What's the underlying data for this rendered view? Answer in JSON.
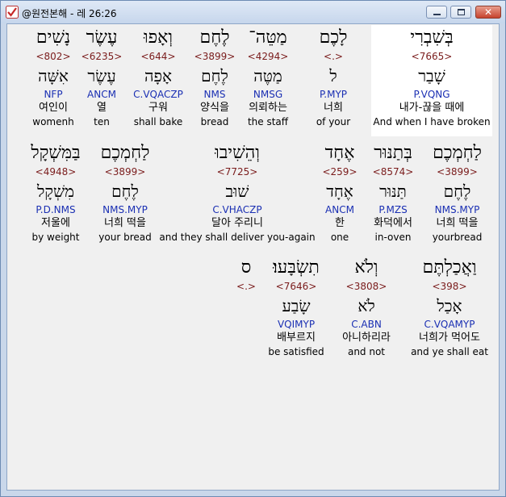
{
  "window": {
    "title": "@원전본해 - 레 26:26",
    "icon": "app-checkmark-icon",
    "close_label": "✕",
    "colors": {
      "strong": "#7a1c1c",
      "morph": "#1a2fb3",
      "title_bg": "#c6d6ec"
    }
  },
  "rows": [
    {
      "words": [
        {
          "heb": "בְּשִׁבְרִי",
          "strong": "<7665>",
          "lemma": "שָׁבַר",
          "morph": "P.VQNG",
          "ko": "내가-끊을 때에",
          "en": "And when I have broken",
          "selected": true
        },
        {
          "heb": "לָכֶם",
          "strong": "<.>",
          "lemma": "ל",
          "morph": "P.MYP",
          "ko": "너희",
          "en": "of your"
        },
        {
          "heb": "מַטֵּה־",
          "strong": "<4294>",
          "lemma": "מַטֶּה",
          "morph": "NMSG",
          "ko": "의뢰하는",
          "en": "the staff"
        },
        {
          "heb": "לֶחֶם",
          "strong": "<3899>",
          "lemma": "לֶחֶם",
          "morph": "NMS",
          "ko": "양식을",
          "en": "bread"
        },
        {
          "heb": "וְאָפוּ",
          "strong": "<644>",
          "lemma": "אָפָה",
          "morph": "C.VQACZP",
          "ko": "구워",
          "en": "shall bake"
        },
        {
          "heb": "עֶשֶׂר",
          "strong": "<6235>",
          "lemma": "עֶשֶׂר",
          "morph": "ANCM",
          "ko": "열",
          "en": "ten"
        },
        {
          "heb": "נָשִׁים",
          "strong": "<802>",
          "lemma": "אִשָּׁה",
          "morph": "NFP",
          "ko": "여인이",
          "en": "womenh"
        }
      ]
    },
    {
      "words": [
        {
          "heb": "לַחְמְכֶם",
          "strong": "<3899>",
          "lemma": "לֶחֶם",
          "morph": "NMS.MYP",
          "ko": "너희 떡을",
          "en": "yourbread"
        },
        {
          "heb": "בְּתַנּוּר",
          "strong": "<8574>",
          "lemma": "תַּנּוּר",
          "morph": "P.MZS",
          "ko": "화덕에서",
          "en": "in-oven"
        },
        {
          "heb": "אֶחָד",
          "strong": "<259>",
          "lemma": "אֶחָד",
          "morph": "ANCM",
          "ko": "한",
          "en": "one"
        },
        {
          "heb": "וְהֵשִׁיבוּ",
          "strong": "<7725>",
          "lemma": "שׁוּב",
          "morph": "C.VHACZP",
          "ko": "달아 주리니",
          "en": "and they shall deliver you-again"
        },
        {
          "heb": "לַחְמְכֶם",
          "strong": "<3899>",
          "lemma": "לֶחֶם",
          "morph": "NMS.MYP",
          "ko": "너희 떡을",
          "en": "your bread"
        },
        {
          "heb": "בַּמִּשְׁקָל",
          "strong": "<4948>",
          "lemma": "מִשְׁקָל",
          "morph": "P.D.NMS",
          "ko": "저울에",
          "en": "by weight"
        }
      ]
    },
    {
      "words": [
        {
          "heb": "וַאֲכַלְתֶּם",
          "strong": "<398>",
          "lemma": "אָכַל",
          "morph": "C.VQAMYP",
          "ko": "너희가 먹어도",
          "en": "and ye shall eat"
        },
        {
          "heb": "וְלֹא",
          "strong": "<3808>",
          "lemma": "לֹא",
          "morph": "C.ABN",
          "ko": "아니하리라",
          "en": "and not"
        },
        {
          "heb": "תִשְׂבָּעוּ׃",
          "strong": "<7646>",
          "lemma": "שָׂבַע",
          "morph": "VQIMYP",
          "ko": "배부르지",
          "en": "be satisfied"
        },
        {
          "heb": "ס",
          "strong": "<.>",
          "lemma": "",
          "morph": "",
          "ko": "",
          "en": ""
        }
      ]
    }
  ]
}
